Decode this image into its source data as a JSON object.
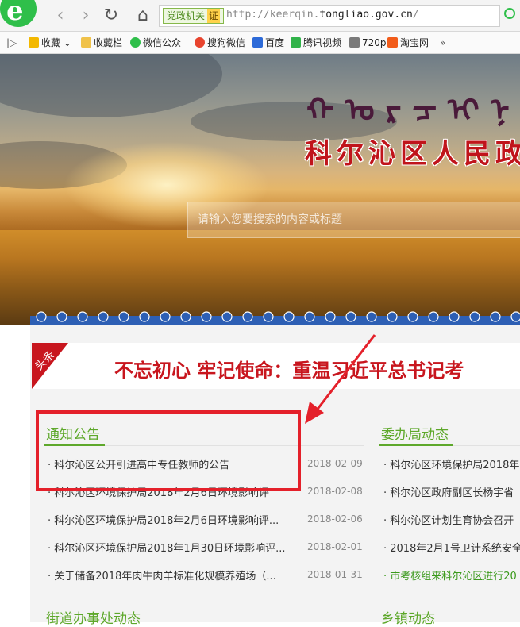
{
  "browser": {
    "back_icon": "back-arrow-icon",
    "forward_icon": "forward-arrow-icon",
    "reload_icon": "reload-icon",
    "home_icon": "home-icon",
    "site_tag": "党政机关",
    "cert_tag": "证",
    "url_prefix": "http://keerqin.",
    "url_domain": "tongliao.gov.cn",
    "url_suffix": "/"
  },
  "favorites": {
    "items": [
      {
        "label": "收藏",
        "icon": "star-icon",
        "color": "#f3b800"
      },
      {
        "label": "收藏栏",
        "icon": "folder-icon",
        "color": "#f0c24a"
      },
      {
        "label": "微信公众",
        "icon": "wechat-icon",
        "color": "#2fbf4a"
      },
      {
        "label": "搜狗微信",
        "icon": "sogou-icon",
        "color": "#e8442e"
      },
      {
        "label": "百度",
        "icon": "baidu-icon",
        "color": "#2d6ad8"
      },
      {
        "label": "腾讯视频",
        "icon": "tencent-video-icon",
        "color": "#31b34a"
      },
      {
        "label": "720p",
        "icon": "720p-icon",
        "color": "#7a7a7a"
      },
      {
        "label": "淘宝网",
        "icon": "taobao-icon",
        "color": "#f25c1a"
      }
    ],
    "more": "»"
  },
  "banner": {
    "mongolian": "ᠬᠣᠷᠴᠢᠨ",
    "title": "科尔沁区人民政",
    "search_placeholder": "请输入您要搜索的内容或标题"
  },
  "headline": {
    "tag": "头条",
    "text": "不忘初心 牢记使命：重温习近平总书记考"
  },
  "notices": {
    "title": "通知公告",
    "items": [
      {
        "text": "· 科尔沁区公开引进高中专任教师的公告",
        "date": "2018-02-09"
      },
      {
        "text": "· 科尔沁区环境保护局2018年2月6日环境影响评",
        "date": "2018-02-08"
      },
      {
        "text": "· 科尔沁区环境保护局2018年2月6日环境影响评...",
        "date": "2018-02-06"
      },
      {
        "text": "· 科尔沁区环境保护局2018年1月30日环境影响评...",
        "date": "2018-02-01"
      },
      {
        "text": "· 关于储备2018年肉牛肉羊标准化规模养殖场（...",
        "date": "2018-01-31"
      }
    ]
  },
  "bureau": {
    "title": "委办局动态",
    "items": [
      {
        "text": "· 科尔沁区环境保护局2018年"
      },
      {
        "text": "· 科尔沁区政府副区长杨宇省"
      },
      {
        "text": "· 科尔沁区计划生育协会召开"
      },
      {
        "text": "· 2018年2月1号卫计系统安全"
      },
      {
        "text": "· 市考核组来科尔沁区进行20"
      }
    ]
  },
  "street": {
    "title": "街道办事处动态"
  },
  "township": {
    "title": "乡镇动态"
  },
  "colors": {
    "accent_green": "#5ea82b",
    "headline_red": "#c8161e",
    "annotation_red": "#e4202a"
  }
}
